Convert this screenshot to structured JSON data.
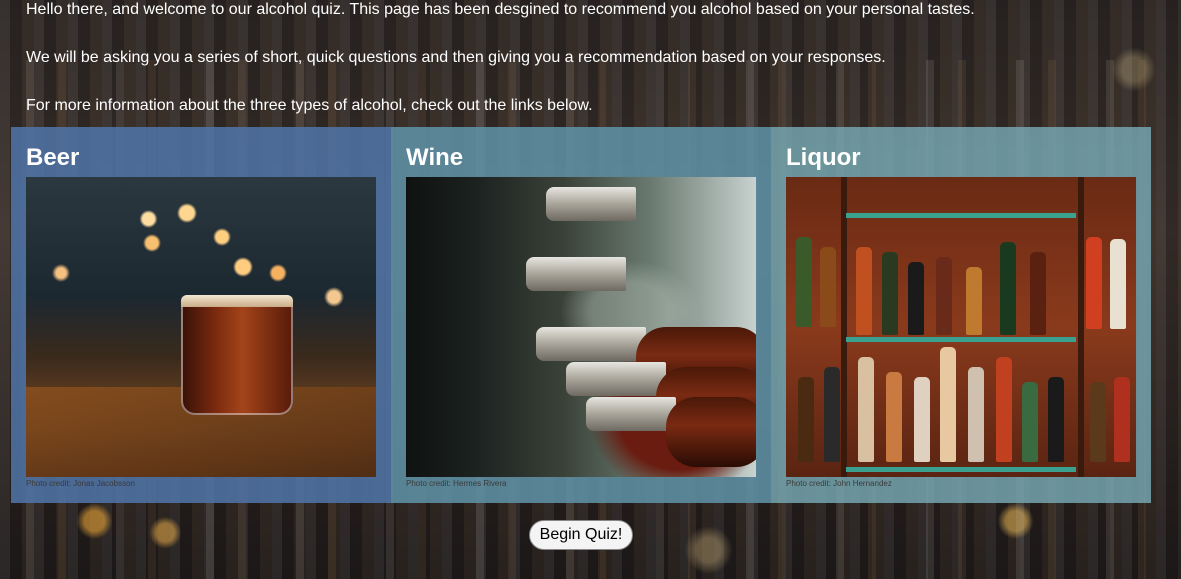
{
  "intro": {
    "line1": "Hello there, and welcome to our alcohol quiz. This page has been desgined to recommend you alcohol based on your personal tastes.",
    "line2": "We will be asking you a series of short, quick questions and then giving you a recommendation based on your responses.",
    "line3": "For more information about the three types of alcohol, check out the links below."
  },
  "cards": [
    {
      "title": "Beer",
      "credit": "Photo credit: Jonas Jacobsson",
      "color": "#4e73a5"
    },
    {
      "title": "Wine",
      "credit": "Photo credit: Hermes Rivera",
      "color": "#5f91a5"
    },
    {
      "title": "Liquor",
      "credit": "Photo credit: John Hernandez",
      "color": "#78aab4"
    }
  ],
  "begin_button": {
    "label": "Begin Quiz!"
  }
}
